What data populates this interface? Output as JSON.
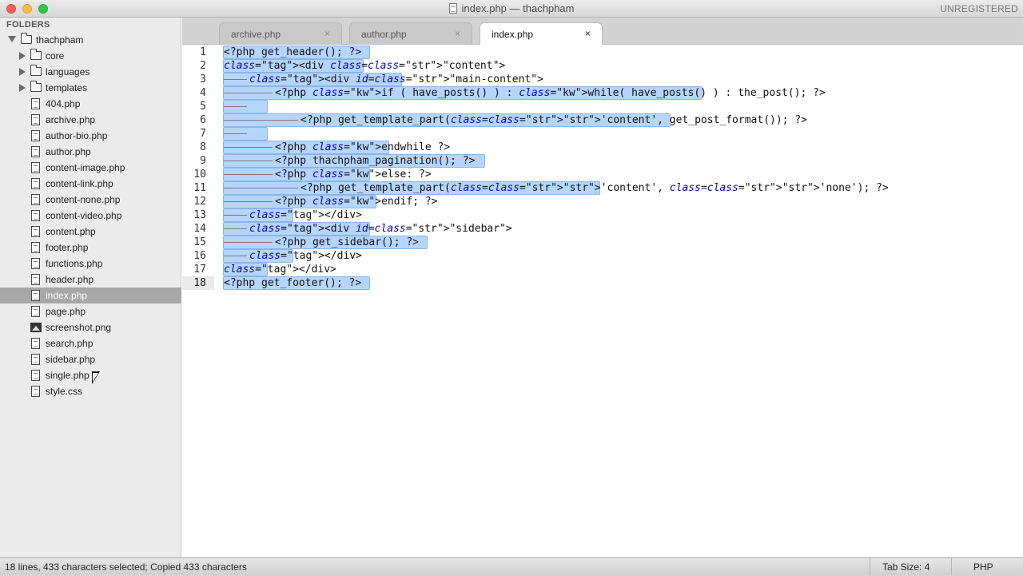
{
  "window": {
    "title": "index.php — thachpham",
    "license": "UNREGISTERED"
  },
  "sidebar": {
    "header": "FOLDERS",
    "root": "thachpham",
    "items": [
      {
        "label": "core",
        "type": "folder"
      },
      {
        "label": "languages",
        "type": "folder"
      },
      {
        "label": "templates",
        "type": "folder"
      },
      {
        "label": "404.php",
        "type": "file"
      },
      {
        "label": "archive.php",
        "type": "file"
      },
      {
        "label": "author-bio.php",
        "type": "file"
      },
      {
        "label": "author.php",
        "type": "file"
      },
      {
        "label": "content-image.php",
        "type": "file"
      },
      {
        "label": "content-link.php",
        "type": "file"
      },
      {
        "label": "content-none.php",
        "type": "file"
      },
      {
        "label": "content-video.php",
        "type": "file"
      },
      {
        "label": "content.php",
        "type": "file"
      },
      {
        "label": "footer.php",
        "type": "file"
      },
      {
        "label": "functions.php",
        "type": "file"
      },
      {
        "label": "header.php",
        "type": "file"
      },
      {
        "label": "index.php",
        "type": "file",
        "selected": true
      },
      {
        "label": "page.php",
        "type": "file"
      },
      {
        "label": "screenshot.png",
        "type": "image"
      },
      {
        "label": "search.php",
        "type": "file"
      },
      {
        "label": "sidebar.php",
        "type": "file"
      },
      {
        "label": "single.php",
        "type": "file"
      },
      {
        "label": "style.css",
        "type": "file"
      }
    ]
  },
  "tabs": [
    {
      "label": "archive.php",
      "active": false
    },
    {
      "label": "author.php",
      "active": false
    },
    {
      "label": "index.php",
      "active": true
    }
  ],
  "tab_close_glyph": "×",
  "editor": {
    "current_line": 18,
    "lines": [
      {
        "n": "1",
        "text": "<?php get_header(); ?>"
      },
      {
        "n": "2",
        "text": "<div class=\"content\">"
      },
      {
        "n": "3",
        "text": "<div id=\"main-content\">"
      },
      {
        "n": "4",
        "text": "<?php if ( have_posts() ) : while( have_posts() ) : the_post(); ?>"
      },
      {
        "n": "5",
        "text": ""
      },
      {
        "n": "6",
        "text": "<?php get_template_part('content', get_post_format()); ?>"
      },
      {
        "n": "7",
        "text": ""
      },
      {
        "n": "8",
        "text": "<?php endwhile ?>"
      },
      {
        "n": "9",
        "text": "<?php thachpham_pagination(); ?>"
      },
      {
        "n": "10",
        "text": "<?php else: ?>"
      },
      {
        "n": "11",
        "text": "<?php get_template_part('content', 'none'); ?>"
      },
      {
        "n": "12",
        "text": "<?php endif; ?>"
      },
      {
        "n": "13",
        "text": "</div>"
      },
      {
        "n": "14",
        "text": "<div id=\"sidebar\">"
      },
      {
        "n": "15",
        "text": "<?php get_sidebar(); ?>"
      },
      {
        "n": "16",
        "text": "</div>"
      },
      {
        "n": "17",
        "text": "</div>"
      },
      {
        "n": "18",
        "text": "<?php get_footer(); ?>"
      }
    ]
  },
  "status": {
    "message": "18 lines, 433 characters selected; Copied 433 characters",
    "tab_size": "Tab Size: 4",
    "syntax": "PHP"
  },
  "colors": {
    "selection": "#b5d5ff",
    "keyword": "#0000cc",
    "string": "#036a07",
    "sidebar_selected": "#a7a7a7"
  }
}
